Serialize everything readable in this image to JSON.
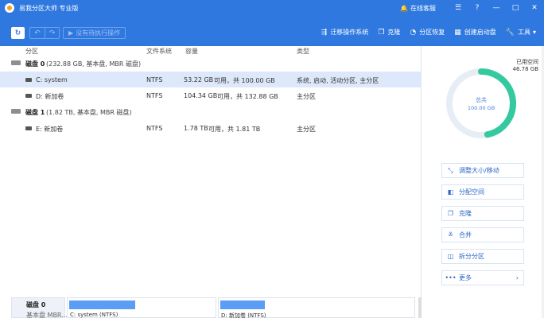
{
  "app": {
    "title": "易我分区大师 专业版",
    "online_support": "在线客服"
  },
  "window_controls": {
    "help": "?",
    "minimize": "—",
    "maximize": "□",
    "close": "✕"
  },
  "toolbar": {
    "pending": "没有待执行操作",
    "items": [
      {
        "label": "迁移操作系统",
        "icon": "migrate-os-icon",
        "glyph": "⇶"
      },
      {
        "label": "克隆",
        "icon": "clone-icon",
        "glyph": "❐"
      },
      {
        "label": "分区恢复",
        "icon": "partition-recovery-icon",
        "glyph": "◔"
      },
      {
        "label": "创建启动盘",
        "icon": "create-bootable-icon",
        "glyph": "▦"
      },
      {
        "label": "工具",
        "icon": "tools-icon",
        "glyph": "🔧"
      }
    ],
    "tools_chevron": "▾"
  },
  "columns": {
    "partition": "分区",
    "filesystem": "文件系统",
    "capacity": "容量",
    "type": "类型"
  },
  "disks": [
    {
      "name": "磁盘 0",
      "info": "(232.88 GB, 基本盘, MBR 磁盘)",
      "partitions": [
        {
          "name": "C: system",
          "fs": "NTFS",
          "used": "53.22 GB",
          "capacity": "可用，共 100.00 GB",
          "type": "系统, 启动, 活动分区, 主分区"
        },
        {
          "name": "D: 新加卷",
          "fs": "NTFS",
          "used": "104.34 GB",
          "capacity": "可用，共 132.88 GB",
          "type": "主分区"
        }
      ]
    },
    {
      "name": "磁盘 1",
      "info": "(1.82 TB, 基本盘, MBR 磁盘)",
      "partitions": [
        {
          "name": "E: 新加卷",
          "fs": "NTFS",
          "used": "1.78 TB",
          "capacity": "可用，共 1.81 TB",
          "type": "主分区"
        }
      ]
    }
  ],
  "disk_map": {
    "disk_name": "磁盘 0",
    "disk_sub": "基本盘 MBR...",
    "parts": [
      {
        "name": "C: system (NTFS)",
        "fill": 0.45
      },
      {
        "name": "D: 新加卷 (NTFS)",
        "fill": 0.23
      }
    ]
  },
  "side": {
    "used_label": "已用空间",
    "used_value": "46.78 GB",
    "total_label": "总共",
    "total_value": "100.00 GB",
    "used_fraction": 0.4678,
    "ring_color": "#35c9a0",
    "ring_bg": "#e7edf5",
    "actions": [
      {
        "label": "调整大小/移动",
        "icon": "resize-move-icon",
        "glyph": "⤡"
      },
      {
        "label": "分配空间",
        "icon": "allocate-space-icon",
        "glyph": "◧"
      },
      {
        "label": "克隆",
        "icon": "clone-icon",
        "glyph": "❐"
      },
      {
        "label": "合并",
        "icon": "merge-icon",
        "glyph": "≚"
      },
      {
        "label": "拆分分区",
        "icon": "split-partition-icon",
        "glyph": "◫"
      },
      {
        "label": "更多",
        "icon": "more-icon",
        "glyph": "•••"
      }
    ],
    "more_chevron": "›"
  }
}
